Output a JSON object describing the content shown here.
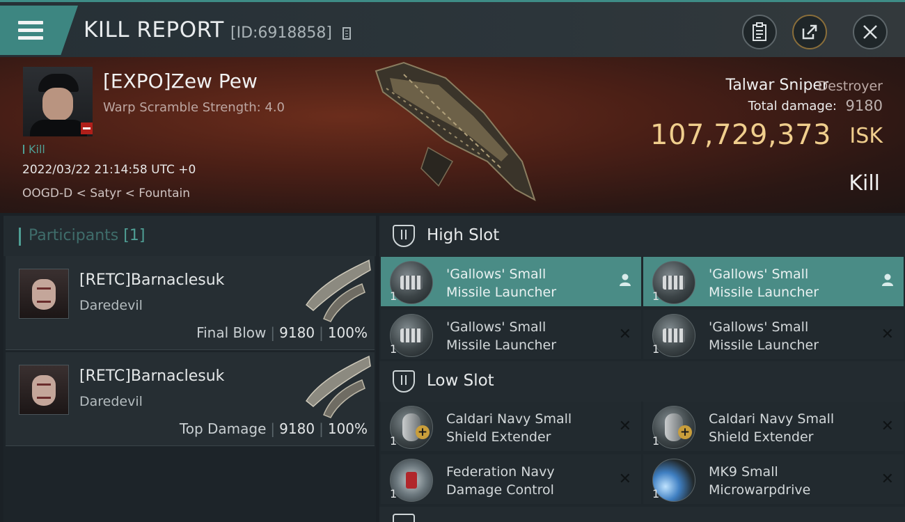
{
  "header": {
    "title": "KILL REPORT",
    "id_label": "[ID:6918858]",
    "icons": [
      "menu-icon",
      "copy-icon",
      "clipboard-icon",
      "share-icon",
      "close-icon"
    ]
  },
  "victim": {
    "pilot_name": "[EXPO]Zew Pew",
    "warp_scramble": "Warp Scramble Strength: 4.0",
    "kills": "Kill",
    "datetime": "2022/03/22 21:14:58 UTC +0",
    "location": "OOGD-D < Satyr < Fountain",
    "ship_name": "Talwar Sniper",
    "ship_class": "Destroyer",
    "total_damage_label": "Total damage:",
    "total_damage": "9180",
    "isk_value": "107,729,373",
    "isk_unit": "ISK",
    "result": "Kill"
  },
  "participants": {
    "title": "Participants",
    "count": "[1]",
    "rows": [
      {
        "name": "[RETC]Barnaclesuk",
        "ship": "Daredevil",
        "role": "Final Blow",
        "damage": "9180",
        "percent": "100%"
      },
      {
        "name": "[RETC]Barnaclesuk",
        "ship": "Daredevil",
        "role": "Top Damage",
        "damage": "9180",
        "percent": "100%"
      }
    ]
  },
  "slots": {
    "high": {
      "title": "High Slot",
      "modules": [
        {
          "qty": "1",
          "line1": "'Gallows' Small",
          "line2": "Missile Launcher",
          "icon": "missile-launcher-icon",
          "status": "person-icon",
          "active": true
        },
        {
          "qty": "1",
          "line1": "'Gallows' Small",
          "line2": "Missile Launcher",
          "icon": "missile-launcher-icon",
          "status": "person-icon",
          "active": true
        },
        {
          "qty": "1",
          "line1": "'Gallows' Small",
          "line2": "Missile Launcher",
          "icon": "missile-launcher-icon",
          "status": "destroyed-icon",
          "active": false
        },
        {
          "qty": "1",
          "line1": "'Gallows' Small",
          "line2": "Missile Launcher",
          "icon": "missile-launcher-icon",
          "status": "destroyed-icon",
          "active": false
        }
      ]
    },
    "low": {
      "title": "Low Slot",
      "modules": [
        {
          "qty": "1",
          "line1": "Caldari Navy Small",
          "line2": "Shield Extender",
          "icon": "shield-extender-icon",
          "status": "destroyed-icon",
          "active": false
        },
        {
          "qty": "1",
          "line1": "Caldari Navy Small",
          "line2": "Shield Extender",
          "icon": "shield-extender-icon",
          "status": "destroyed-icon",
          "active": false
        },
        {
          "qty": "1",
          "line1": "Federation Navy",
          "line2": "Damage Control",
          "icon": "damage-control-icon",
          "status": "destroyed-icon",
          "active": false
        },
        {
          "qty": "1",
          "line1": "MK9 Small",
          "line2": "Microwarpdrive",
          "icon": "microwarpdrive-icon",
          "status": "destroyed-icon",
          "active": false
        }
      ]
    }
  },
  "colors": {
    "accent": "#4a8c86",
    "isk_gold": "#f0ce8d",
    "banner_red": "#4a1f16"
  }
}
